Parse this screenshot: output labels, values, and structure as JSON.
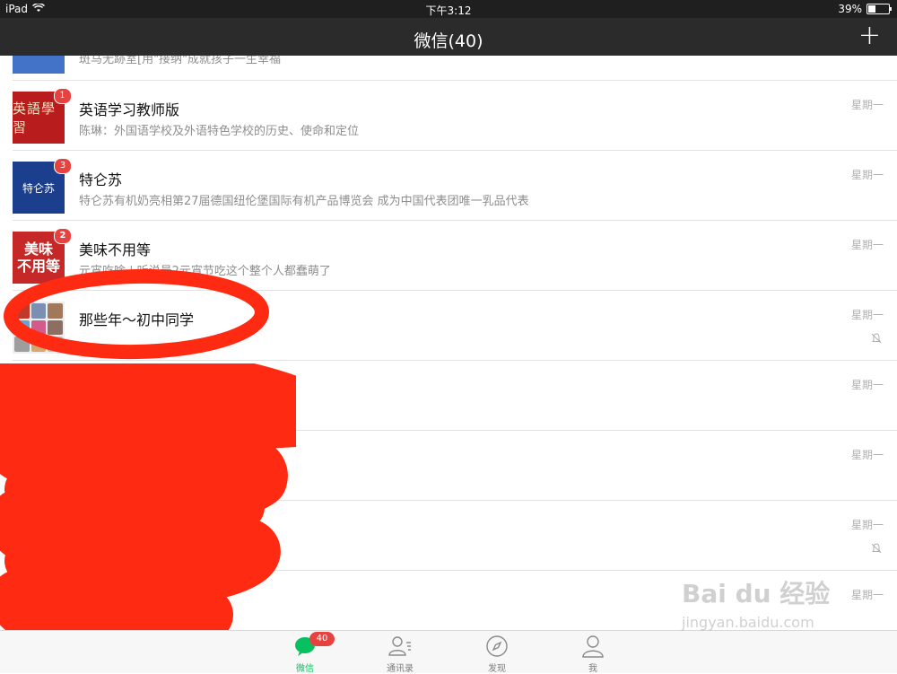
{
  "status_bar": {
    "device": "iPad",
    "time": "下午3:12",
    "battery": "39%",
    "battery_level": 0.39
  },
  "nav": {
    "title": "微信(40)",
    "add_button": "+"
  },
  "chats": [
    {
      "name": "",
      "preview": "斑马无跡室[用\"接纳\"成就孩子一生幸福",
      "date": "",
      "badge": "",
      "muted": false
    },
    {
      "name": "英语学习教师版",
      "preview": "陈琳：外国语学校及外语特色学校的历史、使命和定位",
      "date": "星期一",
      "badge": "1",
      "avatar_text": "英語學習",
      "muted": false
    },
    {
      "name": "特仑苏",
      "preview": "特仑苏有机奶亮相第27届德国纽伦堡国际有机产品博览会 成为中国代表团唯一乳品代表",
      "date": "星期一",
      "badge": "3",
      "avatar_text": "特仑苏",
      "muted": false
    },
    {
      "name": "美味不用等",
      "preview": "元宵吃啥 | 听说最2元宵节吃这个整个人都蠢萌了",
      "date": "星期一",
      "badge": "2",
      "avatar_text": [
        "美味",
        "不用等"
      ],
      "muted": false
    },
    {
      "name": "那些年～初中同学",
      "preview": "",
      "date": "星期一",
      "badge": "",
      "muted": true
    },
    {
      "name": "",
      "preview": "",
      "date": "星期一",
      "badge": "",
      "muted": false
    },
    {
      "name": "",
      "preview": "",
      "date": "星期一",
      "badge": "",
      "muted": false
    },
    {
      "name": "",
      "preview": "",
      "date": "星期一",
      "badge": "",
      "muted": true
    },
    {
      "name": "",
      "preview": "",
      "date": "星期一",
      "badge": "",
      "muted": false
    }
  ],
  "tabs": [
    {
      "label": "微信",
      "icon": "chat-icon",
      "badge": "40",
      "active": true
    },
    {
      "label": "通讯录",
      "icon": "contacts-icon",
      "badge": "",
      "active": false
    },
    {
      "label": "发现",
      "icon": "compass-icon",
      "badge": "",
      "active": false
    },
    {
      "label": "我",
      "icon": "person-icon",
      "badge": "",
      "active": false
    }
  ],
  "watermark": {
    "brand": "Bai du 经验",
    "url": "jingyan.baidu.com"
  },
  "colors": {
    "accent": "#07c160",
    "badge": "#e64340",
    "navbar": "#2b2b2b",
    "redaction": "#ff2a12"
  }
}
